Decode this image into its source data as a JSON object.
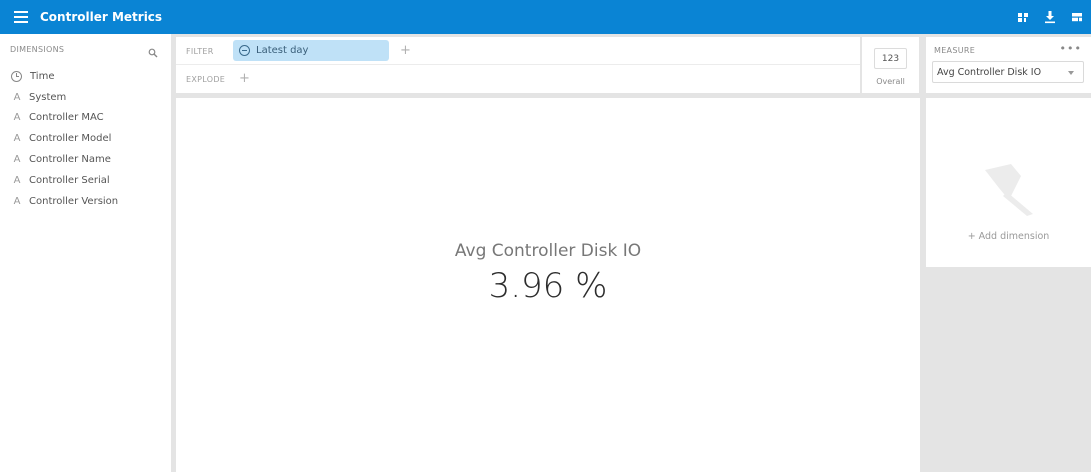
{
  "header": {
    "title": "Controller Metrics",
    "menu_icon": "hamburger-icon",
    "actions": [
      "pin-board-icon",
      "download-icon",
      "layout-icon"
    ]
  },
  "dimensions": {
    "heading": "DIMENSIONS",
    "items": [
      {
        "label": "Time",
        "icon": "clock-icon"
      },
      {
        "label": "System",
        "icon": "string-type-icon"
      },
      {
        "label": "Controller MAC",
        "icon": "string-type-icon"
      },
      {
        "label": "Controller Model",
        "icon": "string-type-icon"
      },
      {
        "label": "Controller Name",
        "icon": "string-type-icon"
      },
      {
        "label": "Controller Serial",
        "icon": "string-type-icon"
      },
      {
        "label": "Controller Version",
        "icon": "string-type-icon"
      }
    ]
  },
  "filter": {
    "label": "FILTER",
    "pill": "Latest day"
  },
  "split": {
    "label": "EXPLODE"
  },
  "overall": {
    "box": "123",
    "label": "Overall"
  },
  "measure": {
    "heading": "MEASURE",
    "more": "•••",
    "selected": "Avg Controller Disk IO"
  },
  "main": {
    "title": "Avg Controller Disk IO",
    "value": "3.96 %"
  },
  "pin": {
    "add_label": "+  Add dimension"
  },
  "colors": {
    "topbar": "#0a84d4",
    "pill": "#bfe1f7",
    "background": "#e4e4e4"
  }
}
